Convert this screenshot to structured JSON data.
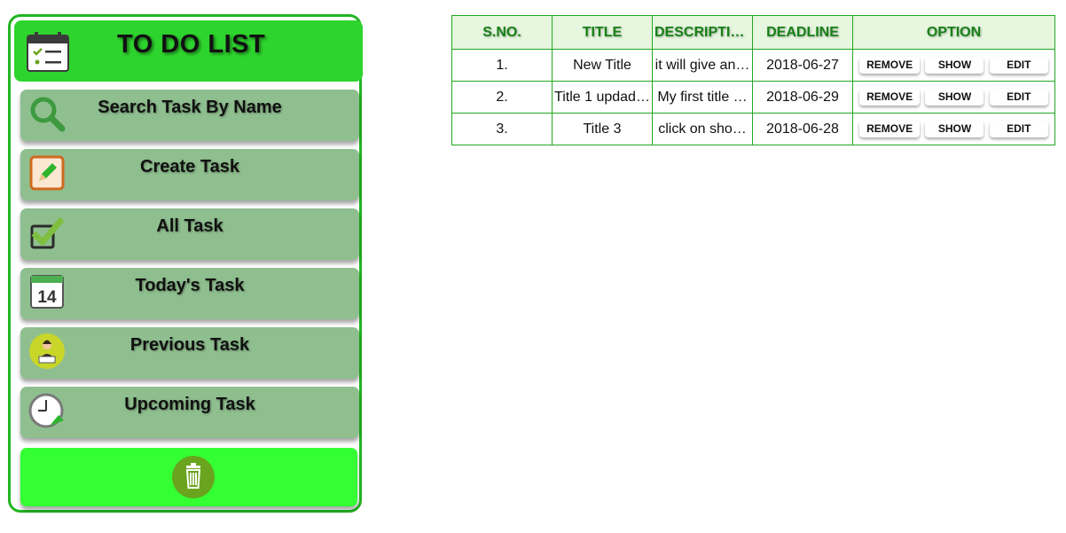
{
  "app": {
    "title": "TO DO LIST"
  },
  "colors": {
    "sidebar_border": "#22b522",
    "header_bg": "#2ed42e",
    "menu_bg": "#8fbf8f",
    "trash_bar_bg": "#33ff33",
    "trash_button_bg": "#6aa41e",
    "table_border": "#22a822",
    "table_header_bg": "#e6f6df",
    "table_header_text": "#178017"
  },
  "sidebar": {
    "header_icon": "calendar-checklist-icon",
    "items": [
      {
        "label": "Search Task By Name",
        "icon": "magnifier-icon"
      },
      {
        "label": "Create Task",
        "icon": "edit-pencil-icon"
      },
      {
        "label": "All Task",
        "icon": "checkbox-tick-icon"
      },
      {
        "label": "Today's Task",
        "icon": "calendar-14-icon"
      },
      {
        "label": "Previous Task",
        "icon": "person-at-laptop-icon"
      },
      {
        "label": "Upcoming Task",
        "icon": "clock-arrow-icon"
      }
    ],
    "trash_icon": "trash-icon"
  },
  "table": {
    "headers": [
      "S.NO.",
      "TITLE",
      "DESCRIPTION",
      "DEADLINE",
      "OPTION"
    ],
    "option_labels": {
      "remove": "REMOVE",
      "show": "SHOW",
      "edit": "EDIT"
    },
    "rows": [
      {
        "sno": "1.",
        "title": "New Title",
        "description": "it will give an…",
        "deadline": "2018-06-27"
      },
      {
        "sno": "2.",
        "title": "Title 1 updad…",
        "description": "My first title …",
        "deadline": "2018-06-29"
      },
      {
        "sno": "3.",
        "title": "Title 3",
        "description": "click on sho…",
        "deadline": "2018-06-28"
      }
    ]
  }
}
